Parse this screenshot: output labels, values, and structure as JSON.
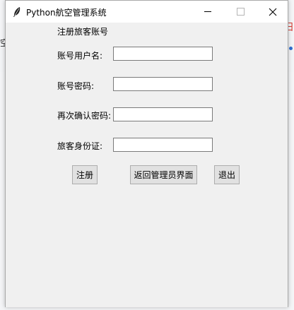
{
  "window": {
    "title": "Python航空管理系统",
    "icon": "feather-icon"
  },
  "background": {
    "left_char": "空",
    "right_char": "日"
  },
  "form": {
    "heading": "注册旅客账号",
    "fields": [
      {
        "label": "账号用户名:",
        "value": ""
      },
      {
        "label": "账号密码:",
        "value": ""
      },
      {
        "label": "再次确认密码:",
        "value": ""
      },
      {
        "label": "旅客身份证:",
        "value": ""
      }
    ]
  },
  "buttons": {
    "register": "注册",
    "back_admin": "返回管理员界面",
    "exit": "退出"
  }
}
